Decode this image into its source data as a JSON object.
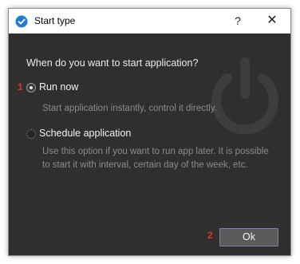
{
  "window": {
    "title": "Start type",
    "help_label": "?",
    "close_label": "✕"
  },
  "question": "When do you want to start application?",
  "markers": {
    "run_now": "1",
    "ok": "2"
  },
  "options": [
    {
      "label": "Run now",
      "description": "Start  application instantly, control it directly.",
      "selected": true
    },
    {
      "label": "Schedule application",
      "description": "Use this option if you want to run app later. It is possible to start it with interval, certain day of the week, etc.",
      "selected": false
    }
  ],
  "ok_button": {
    "label": "Ok"
  },
  "colors": {
    "background": "#2f2f2f",
    "accent_icon": "#1f7bd6",
    "marker": "#e23030",
    "button_border": "#8a7aa8"
  },
  "icons": {
    "app": "check-shield-icon",
    "background": "power-icon"
  }
}
